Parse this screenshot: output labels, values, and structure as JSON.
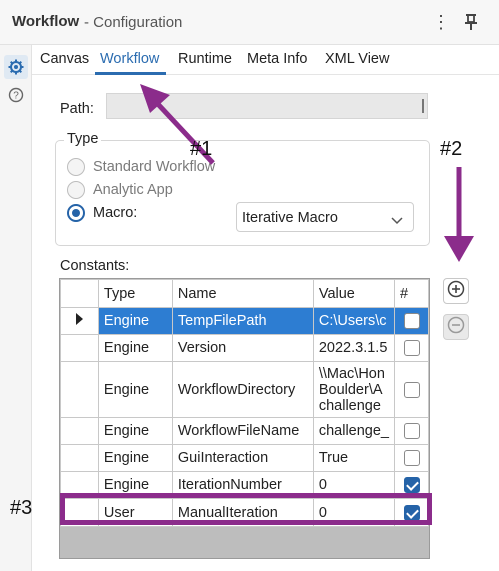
{
  "titlebar": {
    "title": "Workflow",
    "subtitle": "- Configuration",
    "kebab": "⋮"
  },
  "tabs": [
    {
      "label": "Canvas"
    },
    {
      "label": "Workflow",
      "active": true
    },
    {
      "label": "Runtime"
    },
    {
      "label": "Meta Info"
    },
    {
      "label": "XML View"
    }
  ],
  "path": {
    "label": "Path:"
  },
  "type": {
    "legend": "Type",
    "options": [
      {
        "label": "Standard Workflow",
        "selected": false
      },
      {
        "label": "Analytic App",
        "selected": false
      },
      {
        "label": "Macro:",
        "selected": true
      }
    ],
    "macro_select": "Iterative Macro"
  },
  "constants": {
    "label": "Constants:",
    "columns": [
      "Type",
      "Name",
      "Value",
      "#"
    ],
    "rows": [
      {
        "type": "Engine",
        "name": "TempFilePath",
        "value": "C:\\Users\\c",
        "checked": false,
        "selected": true
      },
      {
        "type": "Engine",
        "name": "Version",
        "value": "2022.3.1.5",
        "checked": false
      },
      {
        "type": "Engine",
        "name": "WorkflowDirectory",
        "value": "\\\\Mac\\Hon Boulder\\A challenge",
        "value_lines": [
          "\\\\Mac\\Hon",
          "Boulder\\A",
          "challenge"
        ],
        "checked": false
      },
      {
        "type": "Engine",
        "name": "WorkflowFileName",
        "value": "challenge_",
        "checked": false
      },
      {
        "type": "Engine",
        "name": "GuiInteraction",
        "value": "True",
        "checked": false
      },
      {
        "type": "Engine",
        "name": "IterationNumber",
        "value": "0",
        "checked": true
      },
      {
        "type": "User",
        "name": "ManualIteration",
        "value": "0",
        "checked": true
      }
    ]
  },
  "annotations": {
    "a1": "#1",
    "a2": "#2",
    "a3": "#3"
  },
  "colors": {
    "accent": "#2b6cb0",
    "selection": "#2d7dd2",
    "annotation": "#8b2c8b"
  },
  "icons": {
    "settings": "gear-icon",
    "help": "question-icon",
    "pin": "pin-icon",
    "add": "plus-circle-icon",
    "remove": "minus-circle-icon"
  }
}
